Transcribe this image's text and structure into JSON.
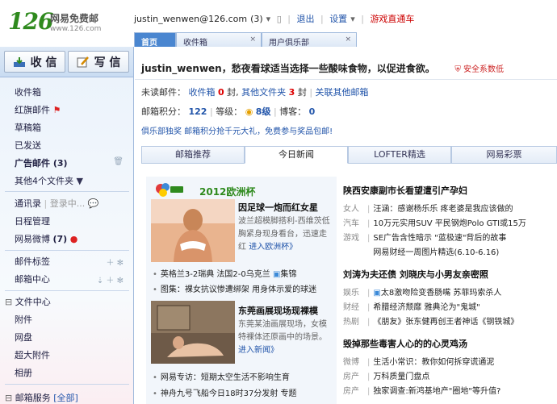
{
  "header": {
    "logo_num": "126",
    "logo_name": "网易免费邮",
    "logo_url": "www.126.com",
    "account": "justin_wenwen@126.com",
    "account_count": "(3)",
    "logout": "退出",
    "settings": "设置",
    "game": "游戏直通车"
  },
  "tabs": [
    {
      "label": "首页"
    },
    {
      "label": "收件箱"
    },
    {
      "label": "用户俱乐部"
    }
  ],
  "sidebar": {
    "receive": "收 信",
    "write": "写 信",
    "items": [
      {
        "label": "收件箱"
      },
      {
        "label": "红旗邮件"
      },
      {
        "label": "草稿箱"
      },
      {
        "label": "已发送"
      },
      {
        "label": "广告邮件 (3)"
      },
      {
        "label": "其他4个文件夹"
      },
      {
        "label": "通讯录"
      },
      {
        "label": "登录中..."
      },
      {
        "label": "日程管理"
      },
      {
        "label": "网易微博"
      },
      {
        "label": "(7)"
      },
      {
        "label": "邮件标签"
      },
      {
        "label": "邮箱中心"
      },
      {
        "label": "文件中心"
      },
      {
        "label": "附件"
      },
      {
        "label": "网盘"
      },
      {
        "label": "超大附件"
      },
      {
        "label": "相册"
      },
      {
        "label": "邮箱服务"
      },
      {
        "label": "[全部]"
      }
    ]
  },
  "main": {
    "greeting": "justin_wenwen，愁夜看球适当选择一些酸味食物，以促进食欲。",
    "safety": "安全系数低",
    "unread_label": "未读邮件：",
    "inbox_label": "收件箱",
    "inbox_count": "0",
    "unit_feng": "封",
    "other_folders": "其他文件夹",
    "other_count": "3",
    "associate": "关联其他邮箱",
    "points_label": "邮箱积分：",
    "points": "122",
    "level_label": "等级：",
    "level": "8级",
    "blog_label": "博客：",
    "blog_count": "0",
    "promo": "俱乐部独奖 邮箱积分抢千元大礼，免费参与奖品包邮!",
    "content_tabs": [
      {
        "label": "邮箱推荐"
      },
      {
        "label": "今日新闻"
      },
      {
        "label": "LOFTER精选"
      },
      {
        "label": "网易彩票"
      }
    ]
  },
  "news_left": {
    "euro_title": "2012欧洲杯",
    "story1_title": "因足球一炮而红女星",
    "story1_desc": "波兰超模脚搭利-西维茨低胸紧身现身看台，迅速走红",
    "story1_link": "进入欧洲杯》",
    "bullet1_a": "英格兰3-2瑞典  法国2-0乌克兰",
    "bullet1_b": "集锦",
    "bullet2": "图集：裸女抗议惨遭绑架  用身体示爱的球迷",
    "story2_title": "东莞画展现场现裸模",
    "story2_desc": "东莞某油画展现场，女模特裸体还原画中的场景。",
    "story2_link": "进入新闻》",
    "bullet3": "网易专访：短期太空生活不影响生育",
    "bullet4": "神舟九号飞船今日18时37分发射 专题"
  },
  "news_right": {
    "head1": "陕西安康副市长看望遭引产孕妇",
    "rows1": [
      {
        "cat": "女人",
        "text": "汪涵：感谢杨乐乐 疼老婆是我应该做的"
      },
      {
        "cat": "汽车",
        "text": "10万元实用SUV 平民钢炮Polo GTI或15万"
      },
      {
        "cat": "游戏",
        "text": "SE广告含性暗示 \"蓝极速\"背后的故事"
      },
      {
        "cat": "",
        "text": "网易财经一周图片精选(6.10-6.16)"
      }
    ],
    "head2": "刘涛为夫还债 刘晓庆与小男友亲密照",
    "rows2": [
      {
        "cat": "娱乐",
        "text": "太8激吻险变香肠嘴 苏菲玛索杀人"
      },
      {
        "cat": "财经",
        "text": "希腊经济颓靡 雅典沦为\"鬼城\""
      },
      {
        "cat": "热剧",
        "text": "《朋友》张东健再创王者神话《钢铁城》"
      }
    ],
    "head3": "毁掉那些毒害人心的的心灵鸡汤",
    "rows3": [
      {
        "cat": "微博",
        "text": "生活小常识：教你如何拆穿谎通泥"
      },
      {
        "cat": "房产",
        "text": "万科质量门盘点"
      },
      {
        "cat": "房产",
        "text": "独家调查:新鸿基地产\"圈地\"等升值?"
      }
    ]
  }
}
